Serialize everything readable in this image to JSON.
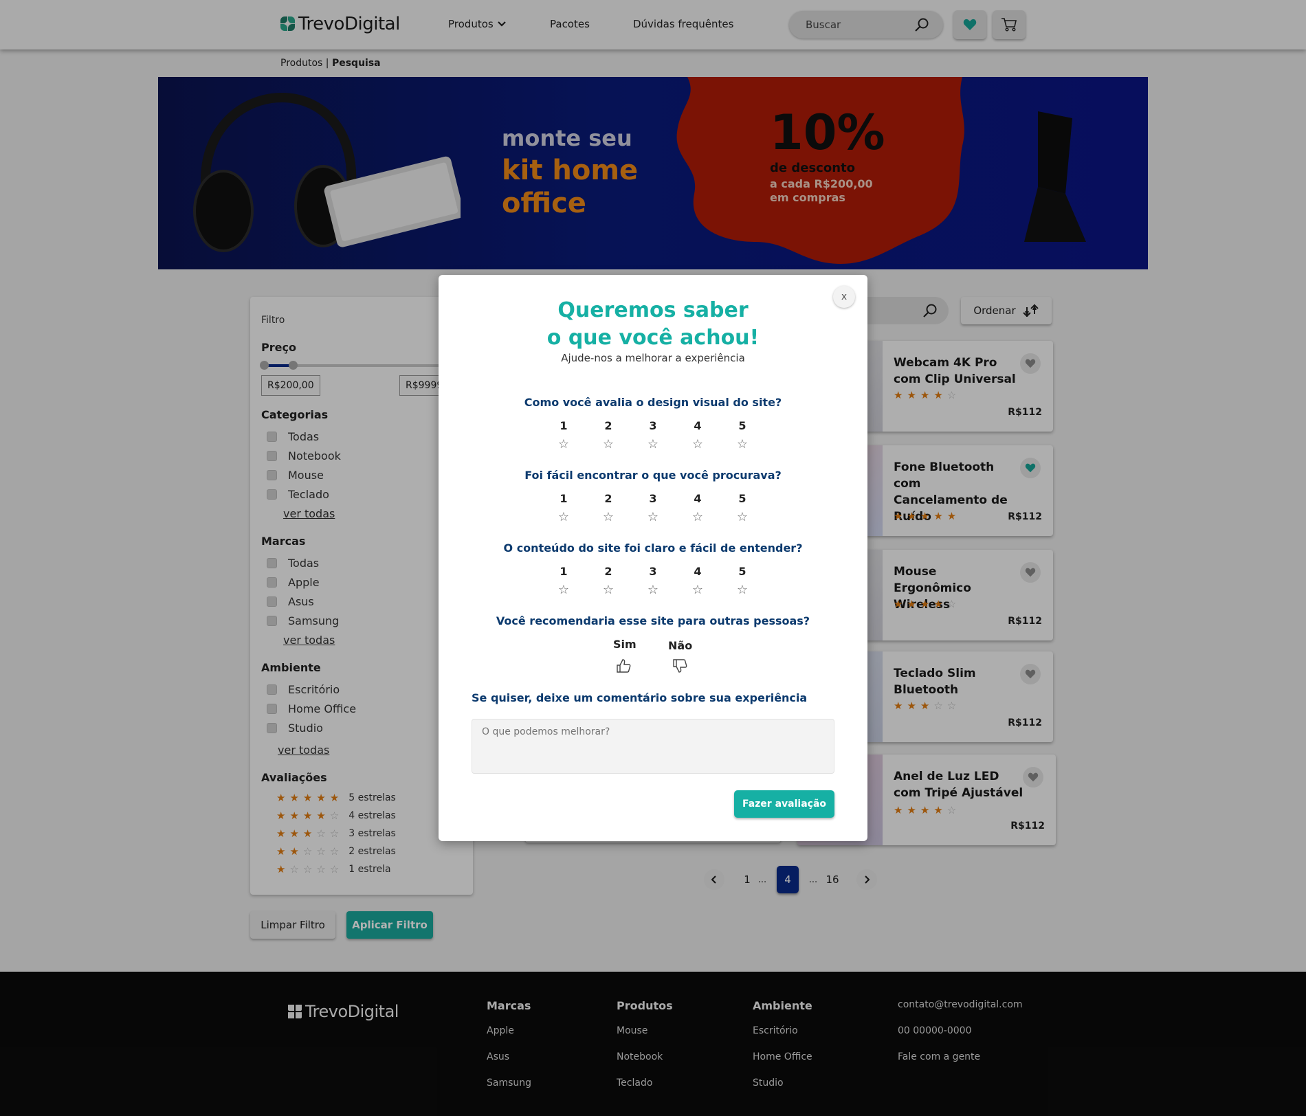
{
  "header": {
    "brand": "TrevoDigital",
    "nav": [
      {
        "label": "Produtos"
      },
      {
        "label": "Pacotes"
      },
      {
        "label": "Dúvidas frequêntes"
      }
    ],
    "search_placeholder": "Buscar"
  },
  "breadcrumb": {
    "parent": "Produtos",
    "separator": "|",
    "current": "Pesquisa"
  },
  "banner": {
    "line1": "monte seu",
    "line2": "kit home",
    "line3": "office",
    "discount": "10%",
    "discount_label": "de desconto",
    "discount_detail": "a cada R$200,00 em compras"
  },
  "filter": {
    "title": "Filtro",
    "price_heading": "Preço",
    "price_min": "R$200,00",
    "price_max": "R$9999",
    "price_range_fraction": [
      0.0,
      0.13
    ],
    "categories_heading": "Categorias",
    "categories": [
      "Todas",
      "Notebook",
      "Mouse",
      "Teclado"
    ],
    "brands_heading": "Marcas",
    "brands": [
      "Todas",
      "Apple",
      "Asus",
      "Samsung"
    ],
    "env_heading": "Ambiente",
    "environments": [
      "Escritório",
      "Home Office",
      "Studio"
    ],
    "see_all": "ver todas",
    "ratings_heading": "Avaliações",
    "ratings": [
      {
        "stars": 5,
        "label": "5 estrelas"
      },
      {
        "stars": 4,
        "label": "4 estrelas"
      },
      {
        "stars": 3,
        "label": "3 estrelas"
      },
      {
        "stars": 2,
        "label": "2 estrelas"
      },
      {
        "stars": 1,
        "label": "1 estrela"
      }
    ],
    "clear_label": "Limpar Filtro",
    "apply_label": "Aplicar Filtro"
  },
  "results": {
    "order_label": "Ordenar",
    "products": [
      {
        "name": "Webcam 4K Pro com Clip Universal",
        "rating": 4,
        "price": "R$112",
        "favorite": false
      },
      {
        "name": "Fone Bluetooth com Cancelamento de Ruído",
        "rating": 5,
        "price": "R$112",
        "favorite": true
      },
      {
        "name": "Mouse Ergonômico Wireless",
        "rating": 4,
        "price": "R$112",
        "favorite": false
      },
      {
        "name": "Teclado Slim Bluetooth",
        "rating": 3,
        "price": "R$112",
        "favorite": false
      },
      {
        "name": "Anel de Luz LED com Tripé Ajustável",
        "rating": 4,
        "price": "R$112",
        "favorite": false
      }
    ],
    "pagination": {
      "first": "1",
      "ellipsis": "...",
      "current": "4",
      "last": "16"
    }
  },
  "modal": {
    "close_label": "x",
    "title_line1": "Queremos saber",
    "title_line2": "o que você achou!",
    "subtitle": "Ajude-nos a melhorar a experiência",
    "questions": [
      "Como você avalia o design visual do site?",
      "Foi fácil encontrar o que você procurava?",
      "O conteúdo do site foi claro e fácil de entender?"
    ],
    "scale": [
      "1",
      "2",
      "3",
      "4",
      "5"
    ],
    "recommend_question": "Você recomendaria esse site para outras pessoas?",
    "yes_label": "Sim",
    "no_label": "Não",
    "comment_question": "Se quiser, deixe um comentário sobre sua experiência",
    "comment_placeholder": "O que podemos melhorar?",
    "submit_label": "Fazer avaliação"
  },
  "footer": {
    "brand": "TrevoDigital",
    "columns": [
      {
        "heading": "Marcas",
        "items": [
          "Apple",
          "Asus",
          "Samsung"
        ]
      },
      {
        "heading": "Produtos",
        "items": [
          "Mouse",
          "Notebook",
          "Teclado"
        ]
      },
      {
        "heading": "Ambiente",
        "items": [
          "Escritório",
          "Home Office",
          "Studio"
        ]
      }
    ],
    "contact": [
      "contato@trevodigital.com",
      "00 00000-0000",
      "Fale com a gente"
    ]
  },
  "colors": {
    "accent": "#16b0a4",
    "primary_dark": "#0a2a8a",
    "star": "#e07c12",
    "banner_blob": "#b01c08"
  }
}
